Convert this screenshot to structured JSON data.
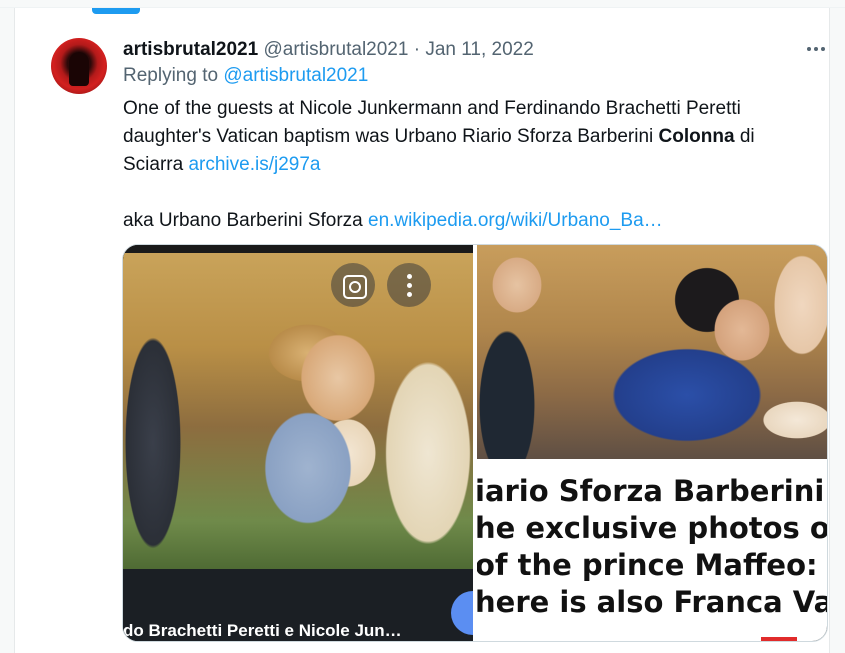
{
  "tweet": {
    "display_name": "artisbrutal2021",
    "handle": "@artisbrutal2021",
    "separator": "·",
    "date": "Jan 11, 2022",
    "replying_to_label": "Replying to ",
    "replying_to_handle": "@artisbrutal2021",
    "text_line1": "One of the guests at Nicole Junkermann and Ferdinando Brachetti Peretti",
    "text_line2_pre": "daughter's Vatican baptism was Urbano Riario Sforza Barberini ",
    "text_line2_bold": "Colonna",
    "text_line2_post": " di",
    "text_line3_pre": "Sciarra ",
    "text_link1": "archive.is/j297a",
    "text_aka": "aka  Urbano Barberini Sforza ",
    "text_link2": "en.wikipedia.org/wiki/Urbano_Ba…"
  },
  "media": {
    "left_caption": "do Brachetti Peretti e Nicole Jun…",
    "right_headline": [
      "iario Sforza Barberini Colo",
      "he exclusive photos of the",
      "of the prince Maffeo: para",
      "here is also Franca Valeri"
    ]
  },
  "icons": {
    "more": "more-horizontal-icon",
    "lens": "google-lens-icon",
    "kebab": "more-vertical-icon"
  },
  "colors": {
    "accent": "#1d9bf0",
    "secondary_text": "#536471",
    "primary_text": "#0f1419"
  }
}
